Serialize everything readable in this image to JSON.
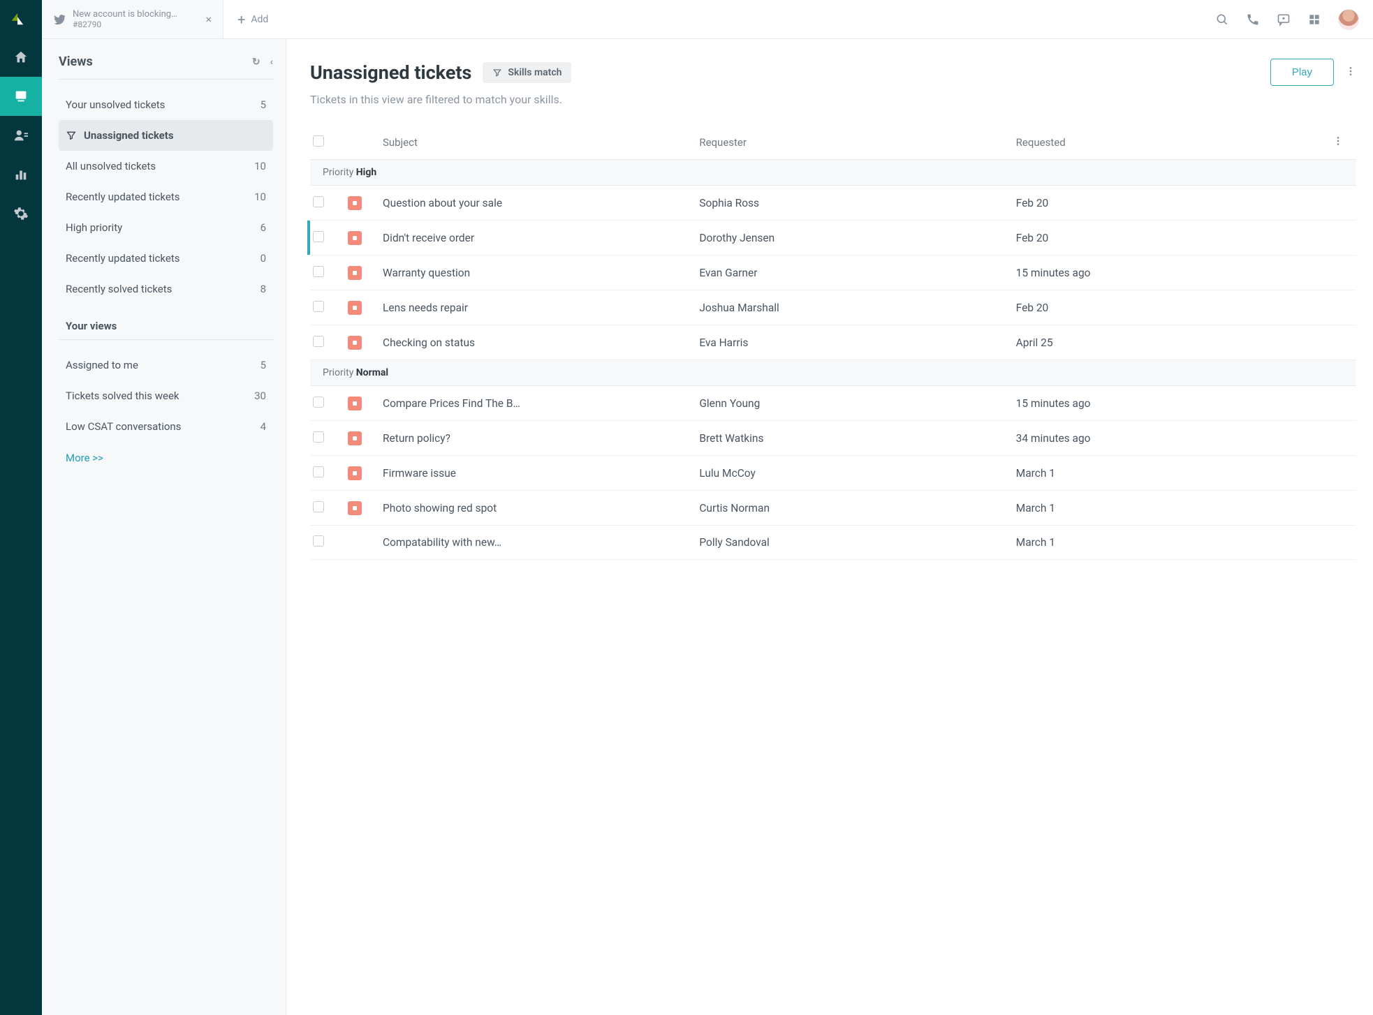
{
  "topbar": {
    "tab_title": "New account is blocking…",
    "tab_sub": "#82790",
    "add_label": "Add"
  },
  "sidebar": {
    "title": "Views",
    "system_views": [
      {
        "label": "Your unsolved tickets",
        "count": "5",
        "active": false
      },
      {
        "label": "Unassigned tickets",
        "count": "",
        "active": true
      },
      {
        "label": "All unsolved tickets",
        "count": "10",
        "active": false
      },
      {
        "label": "Recently updated tickets",
        "count": "10",
        "active": false
      },
      {
        "label": "High priority",
        "count": "6",
        "active": false
      },
      {
        "label": "Recently updated tickets",
        "count": "0",
        "active": false
      },
      {
        "label": "Recently solved tickets",
        "count": "8",
        "active": false
      }
    ],
    "your_views_title": "Your views",
    "your_views": [
      {
        "label": "Assigned to me",
        "count": "5"
      },
      {
        "label": "Tickets solved this week",
        "count": "30"
      },
      {
        "label": "Low CSAT conversations",
        "count": "4"
      }
    ],
    "more_label": "More >>"
  },
  "main": {
    "title": "Unassigned tickets",
    "skills_label": "Skills match",
    "subtitle": "Tickets in this view are filtered to match your skills.",
    "play_label": "Play",
    "columns": {
      "subject": "Subject",
      "requester": "Requester",
      "requested": "Requested"
    },
    "group_label": "Priority",
    "groups": [
      {
        "name": "High",
        "rows": [
          {
            "subject": "Question about your sale",
            "requester": "Sophia Ross",
            "requested": "Feb 20",
            "badge": true,
            "highlight": false
          },
          {
            "subject": "Didn't receive order",
            "requester": "Dorothy Jensen",
            "requested": "Feb 20",
            "badge": true,
            "highlight": true
          },
          {
            "subject": "Warranty question",
            "requester": "Evan Garner",
            "requested": "15 minutes ago",
            "badge": true,
            "highlight": false
          },
          {
            "subject": "Lens needs repair",
            "requester": "Joshua Marshall",
            "requested": "Feb 20",
            "badge": true,
            "highlight": false
          },
          {
            "subject": "Checking on status",
            "requester": "Eva Harris",
            "requested": "April 25",
            "badge": true,
            "highlight": false
          }
        ]
      },
      {
        "name": "Normal",
        "rows": [
          {
            "subject": "Compare Prices Find The B…",
            "requester": "Glenn Young",
            "requested": "15 minutes ago",
            "badge": true,
            "highlight": false
          },
          {
            "subject": "Return policy?",
            "requester": "Brett Watkins",
            "requested": "34 minutes ago",
            "badge": true,
            "highlight": false
          },
          {
            "subject": "Firmware issue",
            "requester": "Lulu McCoy",
            "requested": "March 1",
            "badge": true,
            "highlight": false
          },
          {
            "subject": "Photo showing red spot",
            "requester": "Curtis Norman",
            "requested": "March 1",
            "badge": true,
            "highlight": false
          },
          {
            "subject": "Compatability with new…",
            "requester": "Polly Sandoval",
            "requested": "March 1",
            "badge": false,
            "highlight": false
          }
        ]
      }
    ]
  }
}
